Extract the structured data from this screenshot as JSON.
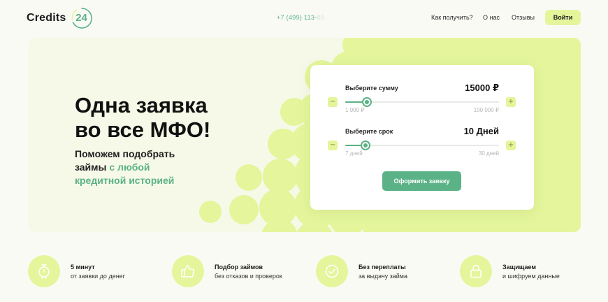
{
  "header": {
    "logo_text": "Credits",
    "logo_number": "24",
    "phone_main": "+7 (499) 113-",
    "phone_dim": "80",
    "nav": {
      "how": "Как получить?",
      "about": "О нас",
      "reviews": "Отзывы"
    },
    "login_label": "Войти"
  },
  "hero": {
    "title_line1": "Одна заявка",
    "title_line2": "во все МФО!",
    "subtitle_line1": "Поможем подобрать",
    "subtitle_line2_plain": "займы ",
    "subtitle_line2_accent": "с любой",
    "subtitle_line3_accent": "кредитной историей"
  },
  "calculator": {
    "sum": {
      "label": "Выберите сумму",
      "value": "15000 ₽",
      "min_label": "1 000 ₽",
      "max_label": "100 000 ₽",
      "min": 1000,
      "max": 100000,
      "current": 15000,
      "minus": "−",
      "plus": "+"
    },
    "term": {
      "label": "Выберите срок",
      "value": "10 Дней",
      "min_label": "7 дней",
      "max_label": "30 дней",
      "min": 7,
      "max": 30,
      "current": 10,
      "minus": "−",
      "plus": "+"
    },
    "submit_label": "Оформить заявку"
  },
  "features": [
    {
      "title": "5 минут",
      "subtitle": "от заявки до денег",
      "icon": "stopwatch-icon"
    },
    {
      "title": "Подбор займов",
      "subtitle": "без отказов и проверок",
      "icon": "thumbs-up-icon"
    },
    {
      "title": "Без переплаты",
      "subtitle": "за выдачу займа",
      "icon": "checkmark-circle-icon"
    },
    {
      "title": "Защищаем",
      "subtitle": "и шифруем данные",
      "icon": "lock-icon"
    }
  ],
  "colors": {
    "accent_green": "#5bb286",
    "lime": "#e4f59b",
    "hero_bg": "#f6f9e8",
    "page_bg": "#fafaf5"
  }
}
